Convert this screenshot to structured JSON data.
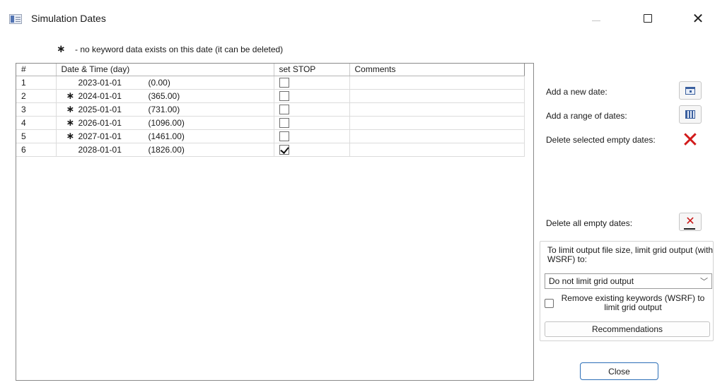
{
  "window": {
    "title": "Simulation Dates",
    "minimize_icon": "minimize-icon",
    "maximize_icon": "maximize-icon",
    "close_icon": "close-icon",
    "close_glyph": "✕"
  },
  "legend": {
    "marker": "∗",
    "text": "- no keyword data exists on this date (it can be deleted)"
  },
  "table": {
    "columns": [
      "#",
      "Date & Time (day)",
      "set STOP",
      "Comments"
    ],
    "rows": [
      {
        "num": "1",
        "marker": "",
        "date": "2023-01-01",
        "day": "(0.00)",
        "stop": false,
        "comment": ""
      },
      {
        "num": "2",
        "marker": "∗",
        "date": "2024-01-01",
        "day": "(365.00)",
        "stop": false,
        "comment": ""
      },
      {
        "num": "3",
        "marker": "∗",
        "date": "2025-01-01",
        "day": "(731.00)",
        "stop": false,
        "comment": ""
      },
      {
        "num": "4",
        "marker": "∗",
        "date": "2026-01-01",
        "day": "(1096.00)",
        "stop": false,
        "comment": ""
      },
      {
        "num": "5",
        "marker": "∗",
        "date": "2027-01-01",
        "day": "(1461.00)",
        "stop": false,
        "comment": ""
      },
      {
        "num": "6",
        "marker": "",
        "date": "2028-01-01",
        "day": "(1826.00)",
        "stop": true,
        "comment": ""
      }
    ]
  },
  "actions": {
    "add_date": {
      "label": "Add a new date:",
      "icon": "calendar-icon"
    },
    "add_range": {
      "label": "Add a range of dates:",
      "icon": "calendar-range-icon"
    },
    "delete_selected": {
      "label": "Delete selected empty dates:",
      "icon": "red-x-icon"
    },
    "delete_all": {
      "label": "Delete all empty dates:",
      "icon": "delete-all-icon"
    }
  },
  "limit_output": {
    "description": "To limit output file size, limit grid output (with WSRF) to:",
    "selected": "Do not limit grid output",
    "remove_checked": false,
    "remove_label": "Remove existing keywords (WSRF) to limit grid output",
    "recommendations_label": "Recommendations"
  },
  "footer": {
    "close_label": "Close"
  },
  "colors": {
    "accent": "#2c6fb7",
    "delete_red": "#d21a1a"
  }
}
